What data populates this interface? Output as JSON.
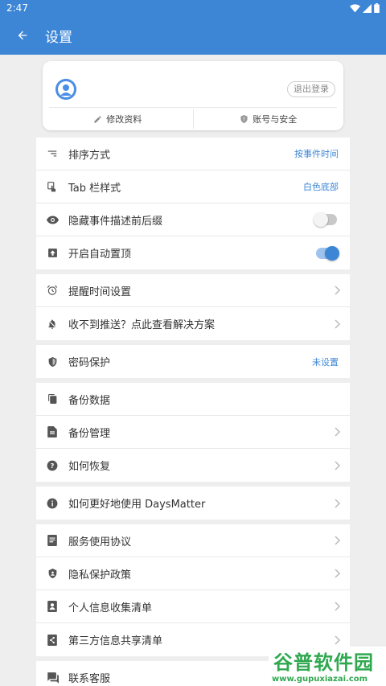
{
  "status_bar": {
    "time": "2:47"
  },
  "app_bar": {
    "title": "设置"
  },
  "profile": {
    "logout_label": "退出登录",
    "edit_profile_label": "修改资料",
    "account_security_label": "账号与安全"
  },
  "groups": [
    {
      "rows": [
        {
          "icon": "sort-icon",
          "label": "排序方式",
          "value": "按事件时间"
        },
        {
          "icon": "touch-icon",
          "label": "Tab 栏样式",
          "value": "白色底部"
        },
        {
          "icon": "eye-icon",
          "label": "隐藏事件描述前后缀",
          "toggle": "off"
        },
        {
          "icon": "pin-top-icon",
          "label": "开启自动置顶",
          "toggle": "on"
        }
      ]
    },
    {
      "rows": [
        {
          "icon": "alarm-icon",
          "label": "提醒时间设置",
          "chevron": true
        },
        {
          "icon": "bell-off-icon",
          "label": "收不到推送？点此查看解决方案",
          "chevron": true
        }
      ]
    },
    {
      "rows": [
        {
          "icon": "shield-icon",
          "label": "密码保护",
          "value": "未设置"
        }
      ]
    },
    {
      "rows": [
        {
          "icon": "copy-icon",
          "label": "备份数据"
        },
        {
          "icon": "file-icon",
          "label": "备份管理",
          "chevron": true
        },
        {
          "icon": "help-icon",
          "label": "如何恢复",
          "chevron": true
        }
      ]
    },
    {
      "rows": [
        {
          "icon": "info-icon",
          "label": "如何更好地使用 DaysMatter",
          "chevron": true
        }
      ]
    },
    {
      "rows": [
        {
          "icon": "document-icon",
          "label": "服务使用协议",
          "chevron": true
        },
        {
          "icon": "privacy-shield-icon",
          "label": "隐私保护政策",
          "chevron": true
        },
        {
          "icon": "contact-card-icon",
          "label": "个人信息收集清单",
          "chevron": true
        },
        {
          "icon": "share-icon",
          "label": "第三方信息共享清单",
          "chevron": true
        }
      ]
    },
    {
      "rows": [
        {
          "icon": "chat-icon",
          "label": "联系客服",
          "chevron": true
        }
      ]
    }
  ],
  "watermark": {
    "text": "谷普软件园",
    "url": "www.gupuxiazai.com"
  },
  "colors": {
    "primary": "#3d86d6",
    "background": "#eeeeee",
    "watermark": "#2fa84f"
  }
}
